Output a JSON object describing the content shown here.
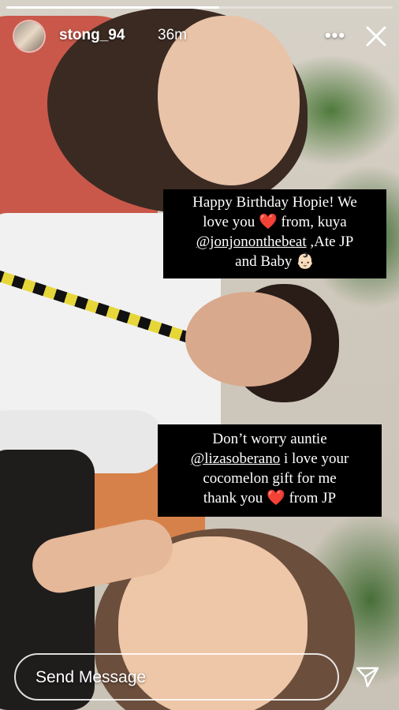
{
  "story": {
    "progress": 0.55
  },
  "header": {
    "username": "stong_94",
    "time_ago": "36m",
    "more_icon": "more-horizontal-icon",
    "more_glyph": "•••",
    "close_icon": "close-icon"
  },
  "captions": {
    "first": {
      "line1": "Happy Birthday Hopie! We",
      "line2_a": "love you",
      "line2_heart": "❤️",
      "line2_b": "from, kuya",
      "line3_mention": "@jonjononthebeat",
      "line3_rest": ",Ate JP",
      "line4_a": "and Baby",
      "line4_emoji": "👶🏻"
    },
    "second": {
      "line1": "Don’t worry auntie",
      "line2_mention": "@lizasoberano",
      "line2_rest": "i love your",
      "line3": "cocomelon gift for me",
      "line4_a": "thank you",
      "line4_heart": "❤️",
      "line4_b": "from JP"
    }
  },
  "footer": {
    "placeholder": "Send Message",
    "send_icon": "send-icon"
  },
  "colors": {
    "caption_bg": "#000000",
    "heart": "#d1182b",
    "text": "#ffffff"
  }
}
